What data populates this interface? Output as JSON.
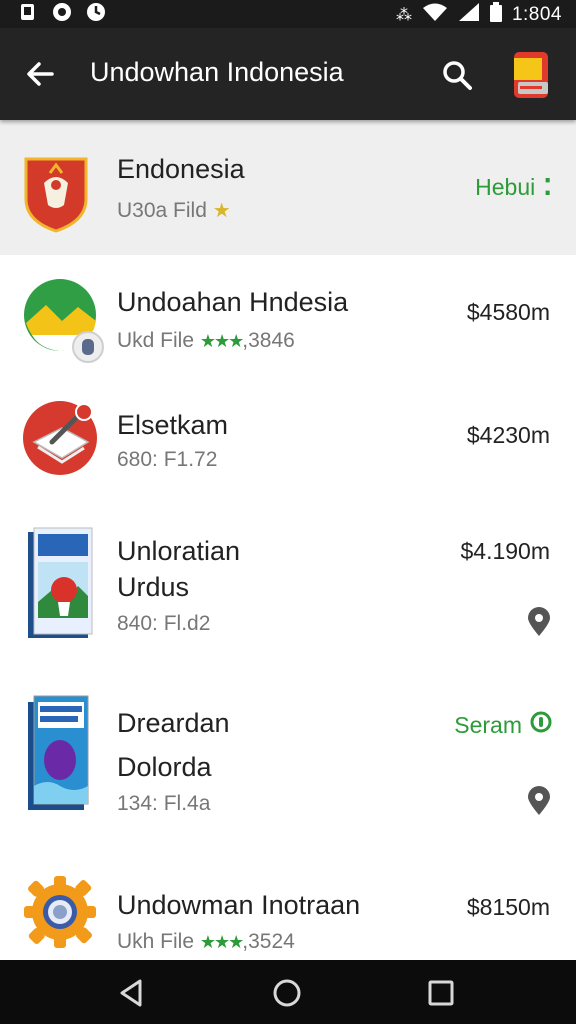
{
  "status_bar": {
    "time": "1:804",
    "left_icons": [
      "notification-icon",
      "camera-icon",
      "app-icon"
    ],
    "right_icons": [
      "vibrate-icon",
      "wifi-icon",
      "signal-icon",
      "battery-icon"
    ]
  },
  "app_bar": {
    "title": "Undowhan Indonesia",
    "back_icon": "arrow-left-icon",
    "search_icon": "search-icon",
    "flag_icon": "flag-icon"
  },
  "items": [
    {
      "name": "Endonesia",
      "subtitle": "U30a Fild",
      "rating_mark": "★",
      "action": "Hebui",
      "icon": "crest-icon"
    },
    {
      "name": "Undoahan Hndesia",
      "subtitle": "Ukd File",
      "stars": "★★★",
      "rating_text": ",3846",
      "price": "$4580m",
      "icon": "map-app-icon"
    },
    {
      "name": "Elsetkam",
      "subtitle": "680: F1.72",
      "price": "$4230m",
      "icon": "notepad-icon"
    },
    {
      "name_line1": "Unloratian",
      "name_line2": "Urdus",
      "subtitle": "840: Fl.d2",
      "price": "$4.190m",
      "icon": "book-cover-icon",
      "pin_icon": "location-pin-icon"
    },
    {
      "name_line1": "Dreardan",
      "name_line2": "Dolorda",
      "subtitle": "134: Fl.4a",
      "action": "Seram",
      "icon": "book-cover-icon",
      "pin_icon": "location-pin-icon"
    },
    {
      "name": "Undowman Inotraan",
      "subtitle": "Ukh File",
      "stars": "★★★",
      "rating_text": ",3524",
      "price": "$8150m",
      "icon": "settings-gear-icon"
    }
  ],
  "nav_bar": {
    "back": "nav-back-icon",
    "home": "nav-home-icon",
    "recents": "nav-recents-icon"
  },
  "colors": {
    "app_bar": "#242424",
    "accent_green": "#2e9b3a",
    "crest_red": "#d43a2a"
  }
}
